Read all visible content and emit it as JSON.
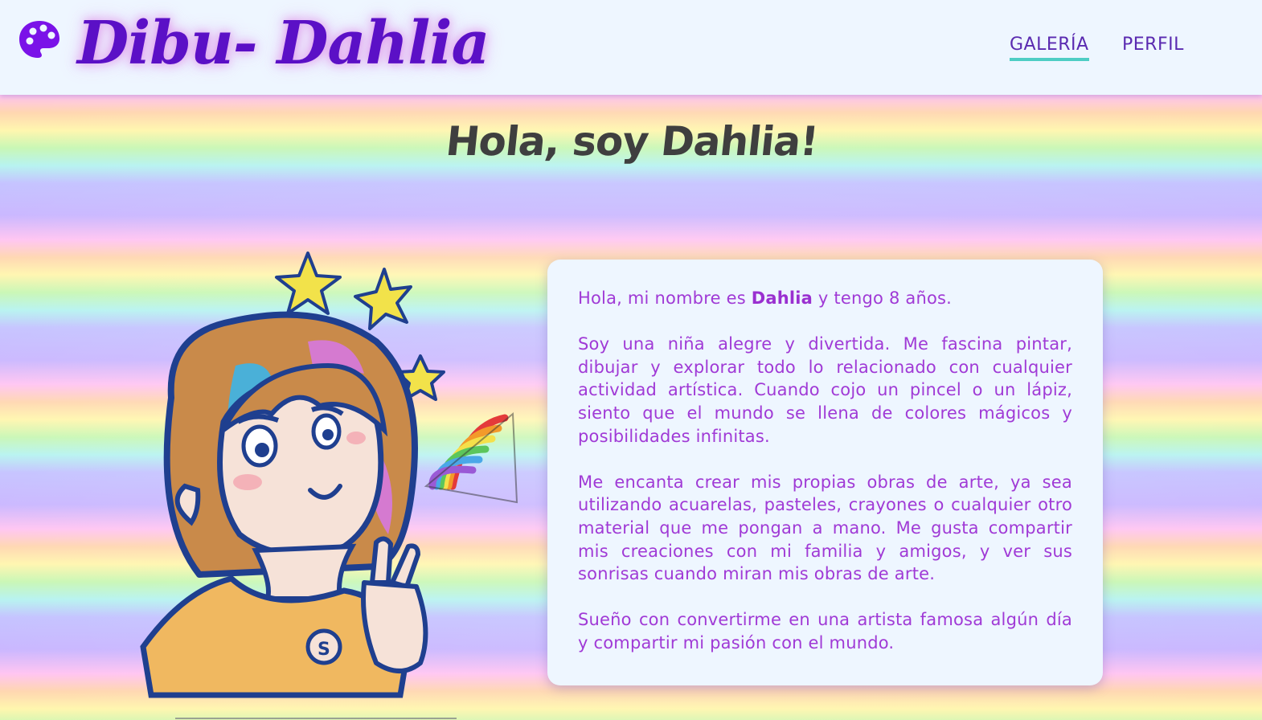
{
  "header": {
    "logo_icon": "palette-icon",
    "title": "Dibu- Dahlia",
    "nav": {
      "galeria": "GALERÍA",
      "perfil": "PERFIL"
    }
  },
  "main": {
    "heading": "Hola, soy Dahlia!",
    "illustration": "child-drawing-illustration",
    "intro": {
      "before": "Hola, mi nombre es ",
      "name": "Dahlia",
      "after": " y tengo 8 años."
    },
    "paragraphs": [
      "Soy una niña alegre y divertida. Me fascina pintar, dibujar y explorar todo lo relacionado con cualquier actividad artística. Cuando cojo un pincel o un lápiz, siento que el mundo se llena de colores mágicos y posibilidades infinitas.",
      "Me encanta crear mis propias obras de arte, ya sea utilizando acuarelas, pasteles, crayones o cualquier otro material que me pongan a mano. Me gusta compartir mis creaciones con mi familia y amigos, y ver sus sonrisas cuando miran mis obras de arte.",
      "Sueño con convertirme en una artista famosa algún día y compartir mi pasión con el mundo."
    ]
  },
  "colors": {
    "brand_purple": "#5b10c6",
    "text_purple": "#a03ad6",
    "nav_underline": "#4ecdc4",
    "header_bg": "#eef6ff"
  }
}
